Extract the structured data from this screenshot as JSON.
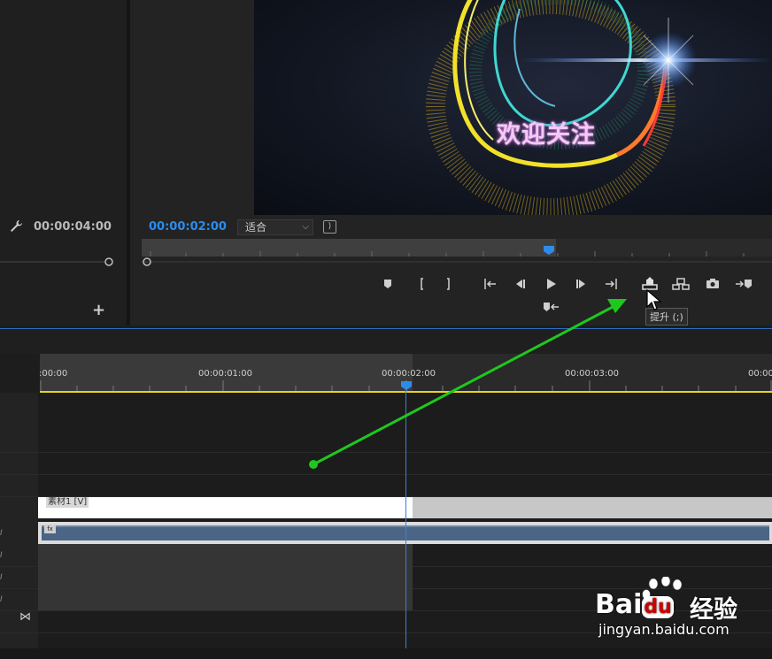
{
  "source_monitor": {
    "timecode": "00:00:04:00",
    "add_button": "+"
  },
  "program_monitor": {
    "video_title": "欢迎关注",
    "timecode": "00:00:02:00",
    "fit_select": {
      "selected": "适合",
      "chevron": "⌵"
    },
    "fit_button": "⟩"
  },
  "transport": {
    "buttons": [
      "add-marker",
      "mark-in",
      "mark-out",
      "go-to-in",
      "step-back",
      "play",
      "step-forward",
      "go-to-out",
      "lift",
      "extract",
      "export-frame",
      "insert",
      "overwrite"
    ],
    "tooltip": "提升 (;)"
  },
  "timeline": {
    "ruler_labels": [
      ":00:00",
      "00:00:01:00",
      "00:00:02:00",
      "00:00:03:00",
      "00:00"
    ],
    "clip_label": "素材1 [V]",
    "fx_label": "fx",
    "track_tags": [
      "I",
      "I",
      "I",
      "I"
    ],
    "sync_icon": "⋈"
  },
  "colors": {
    "accent_blue": "#2d8ceb",
    "timeline_yellow": "#e6d41e",
    "arrow_green": "#1ec81e",
    "audio_clip": "#4a6586"
  },
  "watermark": {
    "brand": "Bai",
    "brand_suffix": "du",
    "chinese": "经验",
    "domain": "jingyan.baidu.com"
  }
}
